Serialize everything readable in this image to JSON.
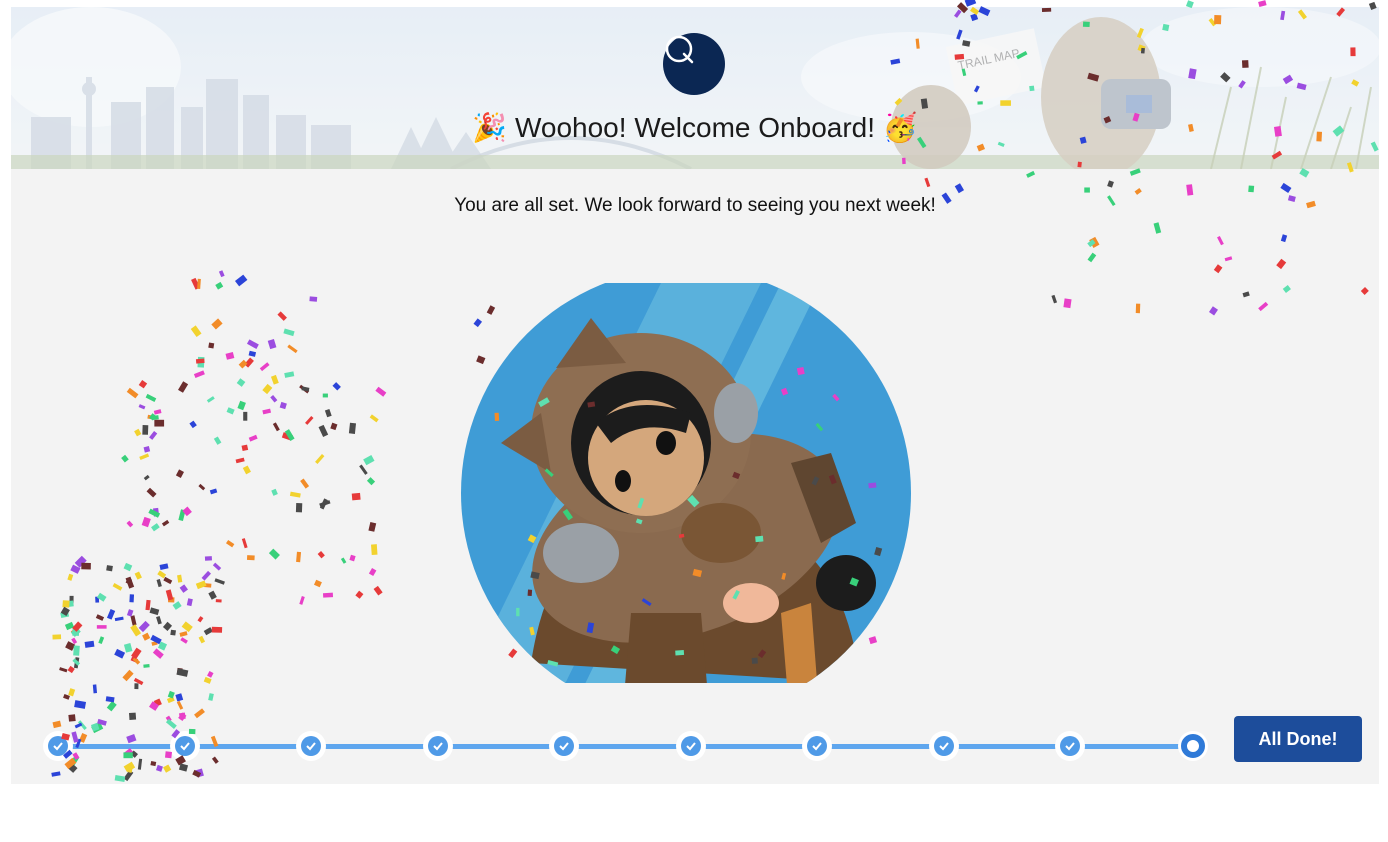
{
  "header": {
    "logo_letter": "Q",
    "title": "🎉 Woohoo! Welcome Onboard! 🥳"
  },
  "main": {
    "message": "You are all set. We look forward to seeing you next week!"
  },
  "progress": {
    "total_steps": 10,
    "completed_steps": 9,
    "current_step": 10
  },
  "actions": {
    "done_label": "All Done!"
  },
  "colors": {
    "accent": "#1d4d9b",
    "logo_bg": "#0b2753",
    "step_complete": "#4f9ae7",
    "track": "#5ea6ee"
  },
  "banner_sign_text": "TRAIL MAP"
}
